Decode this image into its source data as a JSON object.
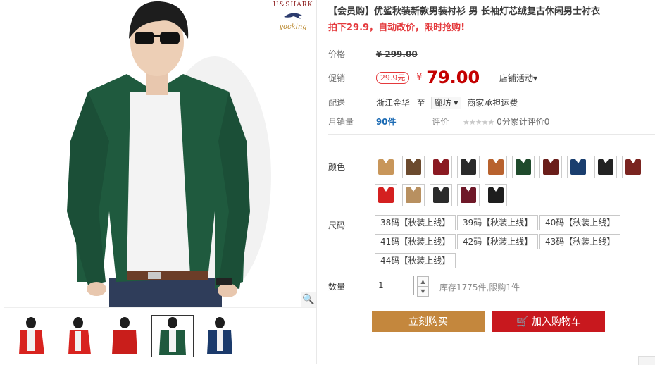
{
  "product": {
    "title": "【会员购】优鲨秋装新款男装衬衫 男 长袖灯芯绒复古休闲男士衬衣",
    "subtitle": "拍下29.9，自动改价，限时抢购!"
  },
  "brand_logo": {
    "top": "U&SHARK",
    "script": "yocking"
  },
  "price": {
    "label": "价格",
    "original": "¥ 299.00"
  },
  "promo": {
    "label": "促销",
    "tag": "29.9元",
    "currency": "¥",
    "price": "79.00",
    "activity": "店铺活动"
  },
  "shipping": {
    "label": "配送",
    "origin": "浙江金华",
    "to": "至",
    "destination": "廊坊",
    "fee": "商家承担运费"
  },
  "sales": {
    "label": "月销量",
    "value": "90件",
    "rating_label": "评价",
    "stars": "★★★★★",
    "rating_text": "0分累计评价0"
  },
  "colors": {
    "label": "颜色",
    "swatches": [
      "#c8965a",
      "#6b4a2e",
      "#8b1a22",
      "#2a2a2a",
      "#b8622e",
      "#1f4a2c",
      "#6a1e1a",
      "#1a3e6e",
      "#222222",
      "#7a2420",
      "#d42020",
      "#b89060",
      "#2b2b2b",
      "#6e1828",
      "#1e1e1e"
    ]
  },
  "sizes": {
    "label": "尺码",
    "options": [
      "38码【秋装上线】",
      "39码【秋装上线】",
      "40码【秋装上线】",
      "41码【秋装上线】",
      "42码【秋装上线】",
      "43码【秋装上线】",
      "44码【秋装上线】"
    ]
  },
  "quantity": {
    "label": "数量",
    "value": "1",
    "stock": "库存1775件,限购1件",
    "up": "▲",
    "down": "▼"
  },
  "actions": {
    "buy_now": "立刻购买",
    "add_to_cart": "加入购物车"
  },
  "icons": {
    "zoom": "🔍",
    "cart": "🛒",
    "dropdown": "▾"
  }
}
